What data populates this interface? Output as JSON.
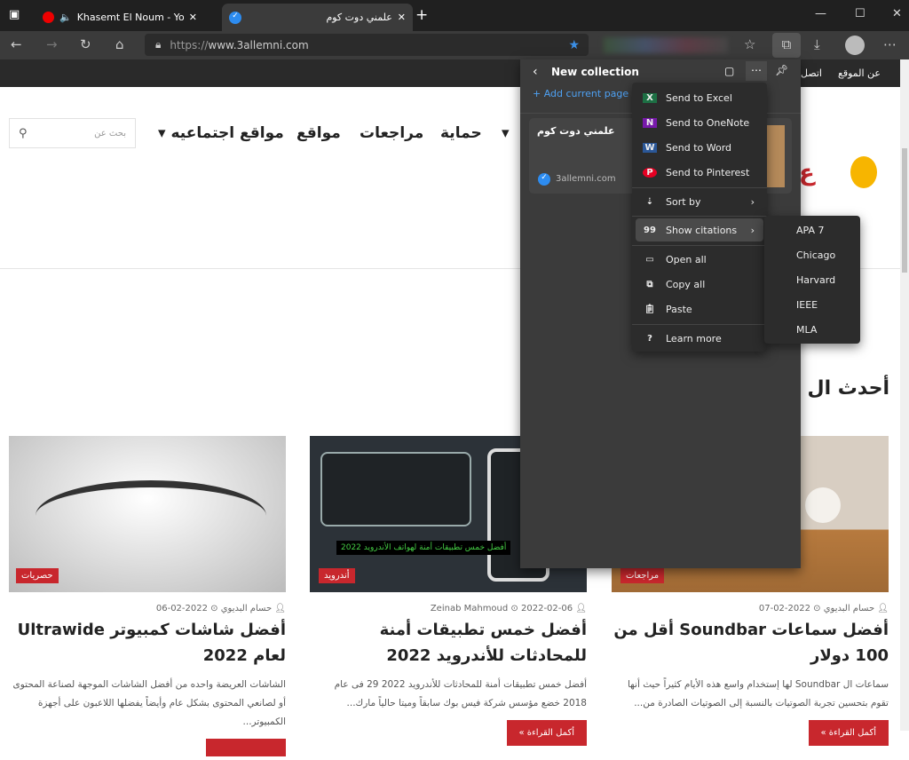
{
  "browser": {
    "tabs": [
      {
        "label": "Khasemt El Noum - YouTube",
        "icon": "youtube-icon"
      },
      {
        "label": "علمني دوت كوم",
        "icon": "site-favicon"
      }
    ],
    "url_prefix": "https://",
    "url_host": "www.3allemni.com"
  },
  "site": {
    "topbar": [
      "عن الموقع",
      "اتصل"
    ],
    "nav": [
      "مواقع اجتماعيه",
      "مواقع",
      "مراجعات",
      "حماية"
    ],
    "search_placeholder": "بحث عن",
    "section_title": "أحدث ال",
    "cards": [
      {
        "badge": "مراجعات",
        "author": "حسام البديوي",
        "date": "2022-02-07",
        "title": "أفضل سماعات Soundbar أقل من 100 دولار",
        "excerpt": "سماعات ال Soundbar لها إستخدام واسع هذه الأيام كثيراً حيث أنها تقوم بتحسين تجربة الصوتيات بالنسبة إلى الصوتيات الصادرة من...",
        "more": "أكمل القراءة »"
      },
      {
        "badge": "أندرويد",
        "author": "Zeinab Mahmoud",
        "date": "2022-02-06",
        "title": "أفضل خمس تطبيقات أمنة للمحادثات للأندرويد 2022",
        "excerpt": "أفضل خمس تطبيقات أمنة للمحادثات للأندرويد 2022 29 فى عام 2018 خضع مؤسس شركة فيس بوك سابقاً وميتا حالياً مارك...",
        "more": "أكمل القراءة »",
        "image_caption": "أفضل خمس تطبيقات أمنة لهواتف الأندرويد 2022"
      },
      {
        "badge": "حصريات",
        "author": "حسام البديوي",
        "date": "2022-02-06",
        "title": "أفضل شاشات كمبيوتر Ultrawide لعام 2022",
        "excerpt": "الشاشات العريضة واحده من أفضل الشاشات الموجهة لصناعة المحتوى أو لصانعي المحتوى بشكل عام وأيضاً يفضلها اللاعبون على أجهزة الكمبيوتر..."
      }
    ]
  },
  "collections": {
    "title": "New collection",
    "add_current": "Add current page",
    "item": {
      "title": "علمني دوت كوم",
      "site": "3allemni.com"
    },
    "menu": [
      {
        "label": "Send to Excel",
        "icon": "excel-icon",
        "color": "#1d7044"
      },
      {
        "label": "Send to OneNote",
        "icon": "onenote-icon",
        "color": "#7719aa"
      },
      {
        "label": "Send to Word",
        "icon": "word-icon",
        "color": "#2b5797"
      },
      {
        "label": "Send to Pinterest",
        "icon": "pinterest-icon",
        "color": "#e60023"
      },
      {
        "label": "Sort by",
        "icon": "sort-icon"
      },
      {
        "label": "Show citations",
        "icon": "quote-icon"
      },
      {
        "label": "Open all",
        "icon": "window-icon"
      },
      {
        "label": "Copy all",
        "icon": "copy-icon"
      },
      {
        "label": "Paste",
        "icon": "paste-icon"
      },
      {
        "label": "Learn more",
        "icon": "help-icon"
      }
    ],
    "citations": [
      "APA 7",
      "Chicago",
      "Harvard",
      "IEEE",
      "MLA"
    ]
  },
  "colors": {
    "accent": "#c8272d",
    "link": "#4ea1f3"
  }
}
